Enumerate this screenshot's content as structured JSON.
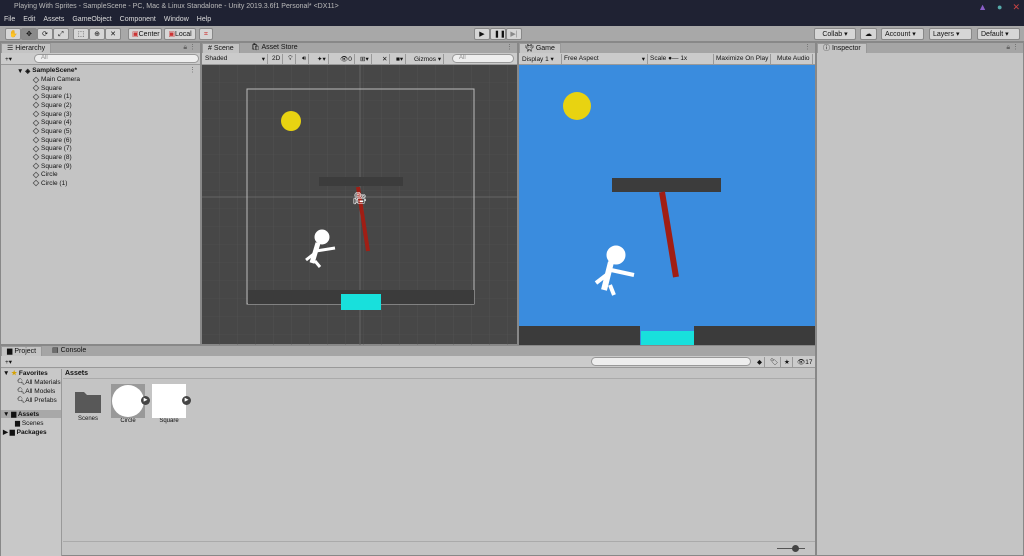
{
  "window": {
    "title": "Playing With Sprites - SampleScene - PC, Mac & Linux Standalone - Unity 2019.3.6f1 Personal* <DX11>"
  },
  "menu": [
    "File",
    "Edit",
    "Assets",
    "GameObject",
    "Component",
    "Window",
    "Help"
  ],
  "toolbar": {
    "center": "Center",
    "local": "Local",
    "collab": "Collab ▾",
    "account": "Account",
    "layers": "Layers",
    "layout": "Default"
  },
  "hierarchy": {
    "tab": "Hierarchy",
    "search_placeholder": "All",
    "scene": "SampleScene*",
    "items": [
      "Main Camera",
      "Square",
      "Square (1)",
      "Square (2)",
      "Square (3)",
      "Square (4)",
      "Square (5)",
      "Square (6)",
      "Square (7)",
      "Square (8)",
      "Square (9)",
      "Circle",
      "Circle (1)"
    ]
  },
  "scene": {
    "tab": "Scene",
    "tab2": "Asset Store",
    "shading": "Shaded",
    "mode2d": "2D",
    "hidden": "0",
    "gizmos": "Gizmos",
    "search_placeholder": "All"
  },
  "game": {
    "tab": "Game",
    "display": "Display 1",
    "aspect": "Free Aspect",
    "scale_label": "Scale",
    "scale_value": "1x",
    "maximize": "Maximize On Play",
    "mute": "Mute Audio",
    "colors": {
      "sky": "#3a8cde",
      "sun": "#e8d311",
      "pole": "#a01e14",
      "water": "#18e0dc"
    }
  },
  "inspector": {
    "tab": "Inspector"
  },
  "project": {
    "tab": "Project",
    "tab2": "Console",
    "favorites": "Favorites",
    "fav_items": [
      "All Materials",
      "All Models",
      "All Prefabs"
    ],
    "assets": "Assets",
    "asset_children": [
      "Scenes"
    ],
    "packages": "Packages",
    "breadcrumb": "Assets",
    "count": "17",
    "asset_items": [
      "Scenes",
      "Circle",
      "Square"
    ]
  }
}
